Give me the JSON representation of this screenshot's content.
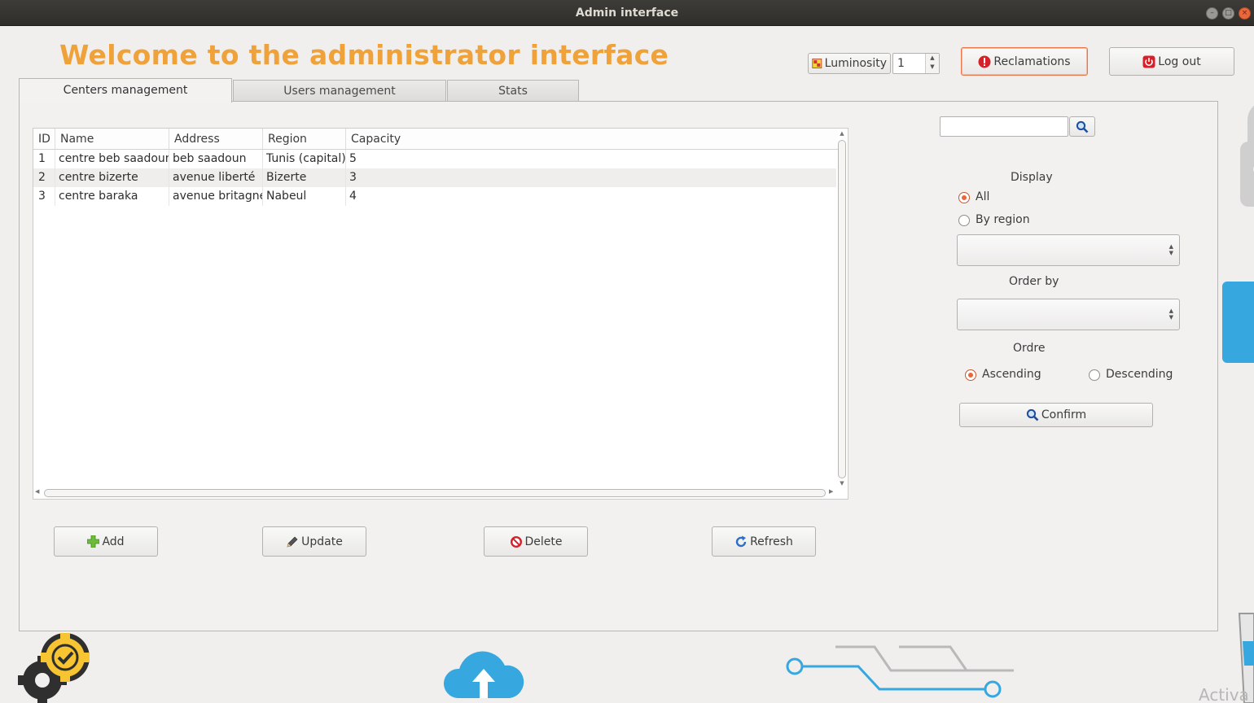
{
  "window": {
    "title": "Admin interface"
  },
  "header": {
    "welcome": "Welcome to the administrator interface",
    "luminosity_label": "Luminosity",
    "luminosity_value": "1",
    "reclamations_label": "Reclamations",
    "logout_label": "Log out"
  },
  "tabs": [
    {
      "label": "Centers management",
      "active": true
    },
    {
      "label": "Users management",
      "active": false
    },
    {
      "label": "Stats",
      "active": false
    }
  ],
  "table": {
    "columns": [
      "ID",
      "Name",
      "Address",
      "Region",
      "Capacity"
    ],
    "rows": [
      [
        "1",
        "centre beb saadoun",
        "beb saadoun",
        "Tunis (capital)",
        "5"
      ],
      [
        "2",
        "centre bizerte",
        "avenue liberté",
        "Bizerte",
        "3"
      ],
      [
        "3",
        "centre baraka",
        "avenue britagne",
        "Nabeul",
        "4"
      ]
    ]
  },
  "actions": {
    "add": "Add",
    "update": "Update",
    "delete": "Delete",
    "refresh": "Refresh"
  },
  "filters": {
    "search_value": "",
    "display_label": "Display",
    "display_all": "All",
    "display_by_region": "By region",
    "display_selected": "All",
    "region_value": "",
    "order_by_label": "Order by",
    "order_by_value": "",
    "ordre_label": "Ordre",
    "ascending": "Ascending",
    "descending": "Descending",
    "ordre_selected": "Ascending",
    "confirm": "Confirm"
  },
  "watermark": "Activa",
  "colors": {
    "accent_orange": "#f0a23a",
    "focus_border": "#e9764d",
    "radio_on": "#e9673d",
    "cloud_blue": "#37a7e0"
  }
}
